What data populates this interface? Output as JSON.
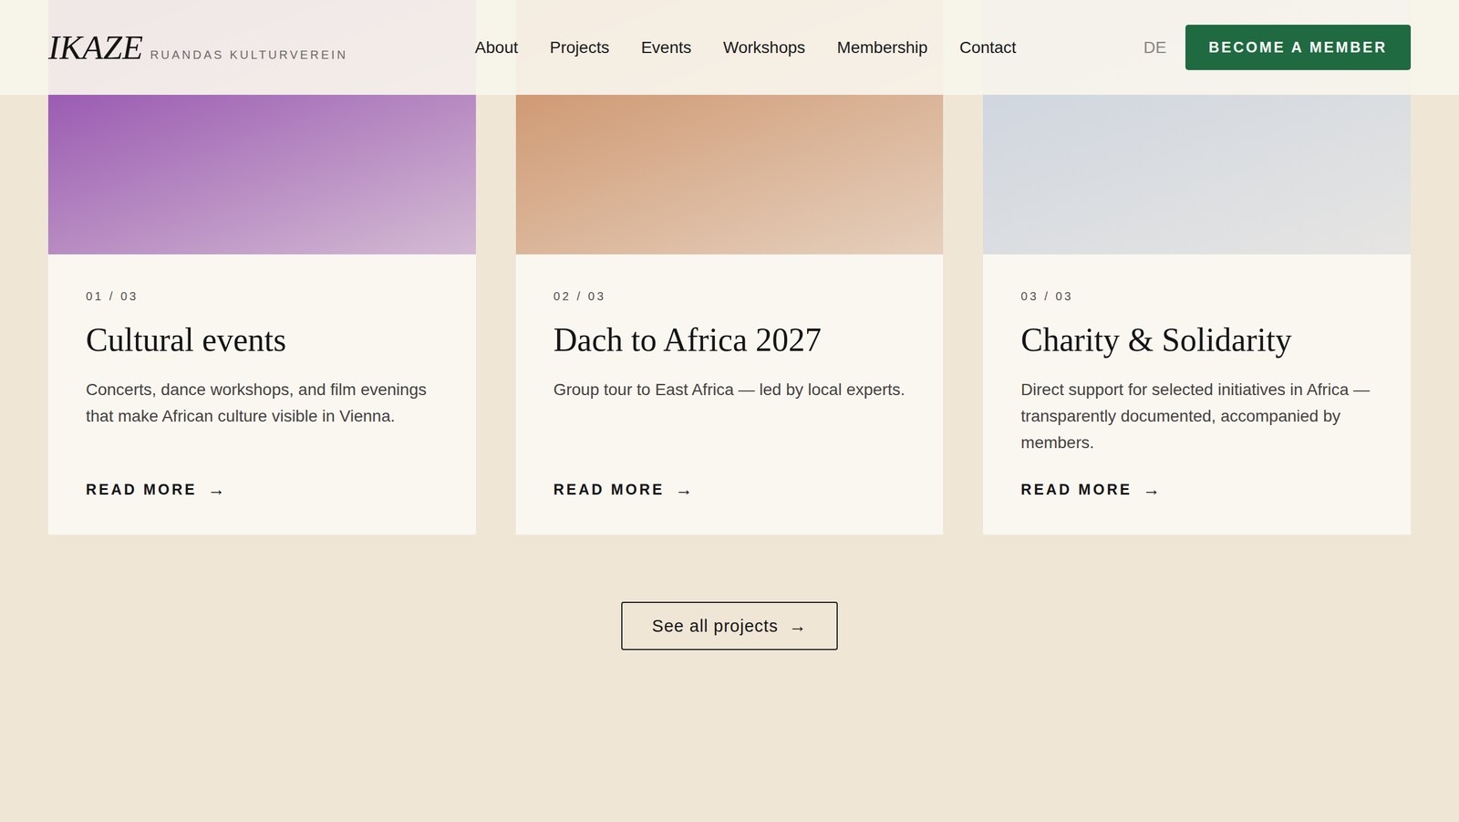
{
  "header": {
    "logo": "IKAZE",
    "tagline": "RUANDAS KULTURVEREIN",
    "nav": [
      {
        "label": "About"
      },
      {
        "label": "Projects"
      },
      {
        "label": "Events"
      },
      {
        "label": "Workshops"
      },
      {
        "label": "Membership"
      },
      {
        "label": "Contact"
      }
    ],
    "language": "DE",
    "cta": "BECOME A MEMBER"
  },
  "cards": [
    {
      "index": "01 / 03",
      "title": "Cultural events",
      "description": "Concerts, dance workshops, and film evenings that make African culture visible in Vienna.",
      "link": "READ MORE",
      "arrow": "→",
      "color": "#8a3fa8"
    },
    {
      "index": "02 / 03",
      "title": "Dach to Africa 2027",
      "description": "Group tour to East Africa — led by local experts.",
      "link": "READ MORE",
      "arrow": "→",
      "color": "#c98a5e"
    },
    {
      "index": "03 / 03",
      "title": "Charity & Solidarity",
      "description": "Direct support for selected initiatives in Africa — transparently documented, accompanied by members.",
      "link": "READ MORE",
      "arrow": "→",
      "color": "#c9d2de"
    }
  ],
  "all_projects": {
    "label": "See all projects",
    "arrow": "→"
  }
}
